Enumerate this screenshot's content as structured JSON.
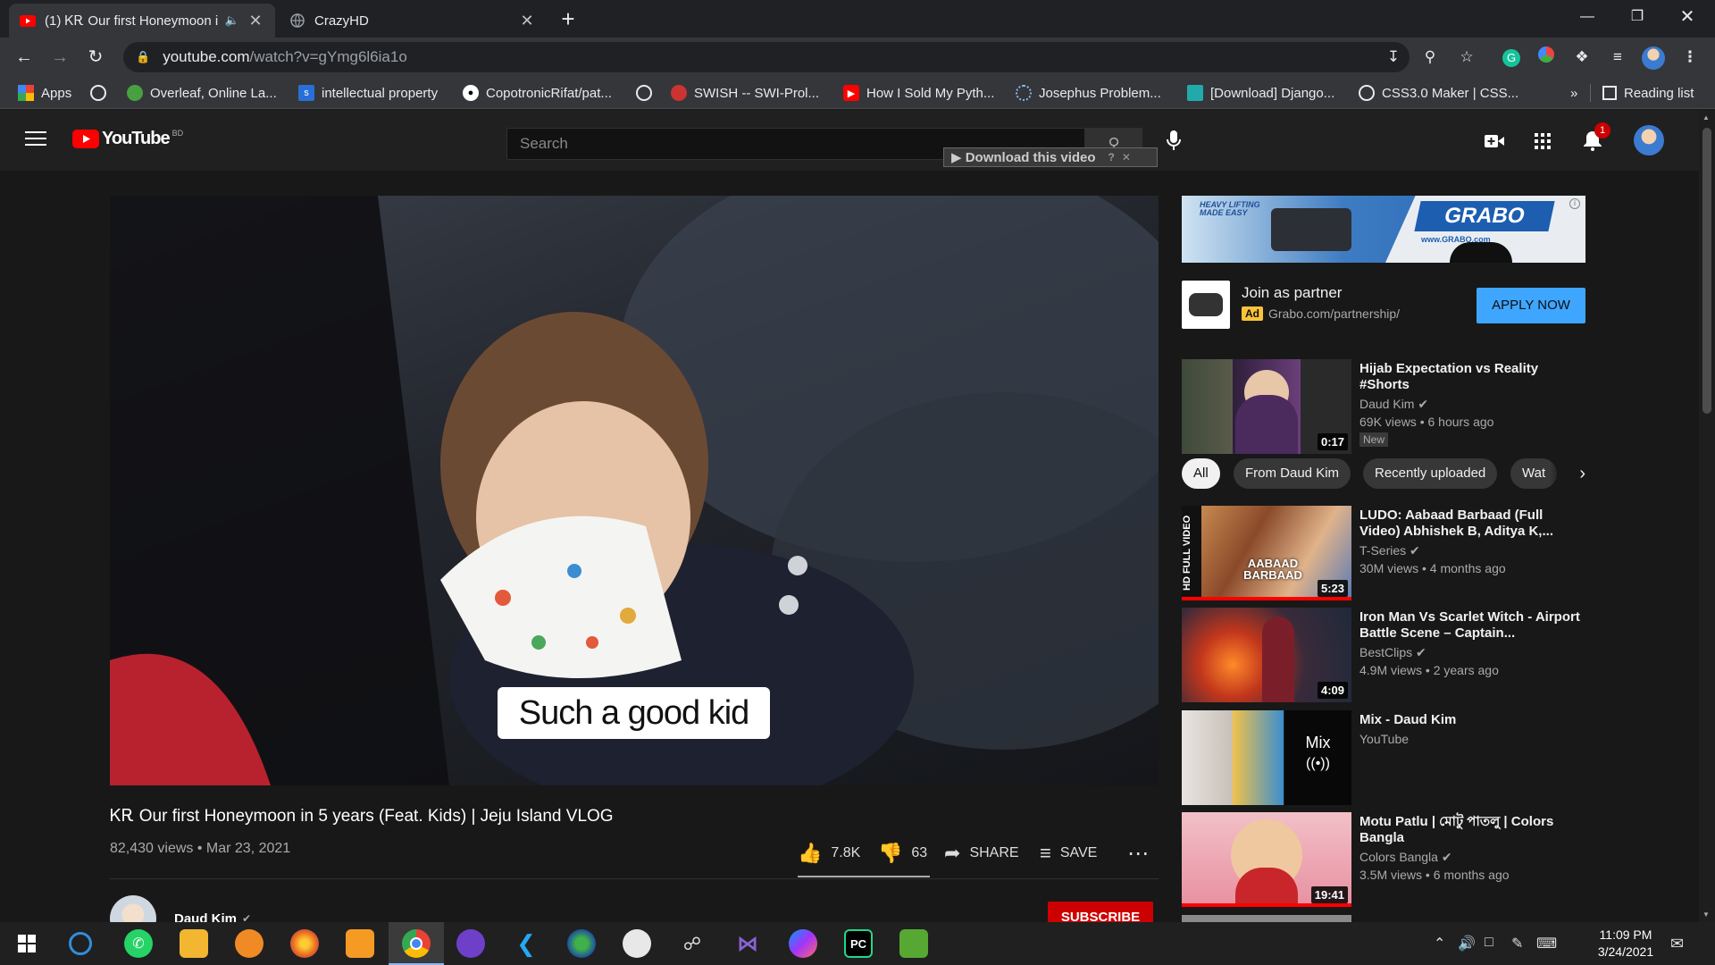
{
  "browser": {
    "tabs": [
      {
        "title": "(1) ᏦᎡ Our first Honeymoon i",
        "active": true
      },
      {
        "title": "CrazyHD",
        "active": false
      }
    ],
    "url_host": "youtube.com",
    "url_path": "/watch?v=gYmg6l6ia1o",
    "bookmarks": [
      {
        "label": "Apps"
      },
      {
        "label": ""
      },
      {
        "label": "Overleaf, Online La..."
      },
      {
        "label": "intellectual property"
      },
      {
        "label": "CopotronicRifat/pat..."
      },
      {
        "label": ""
      },
      {
        "label": "SWISH -- SWI-Prol..."
      },
      {
        "label": "How I Sold My Pyth..."
      },
      {
        "label": "Josephus Problem..."
      },
      {
        "label": "[Download] Django..."
      },
      {
        "label": "CSS3.0 Maker | CSS..."
      }
    ],
    "overflow_label": "»",
    "reading_list": "Reading list",
    "profile_badge": "G"
  },
  "youtube": {
    "logo_text": "YouTube",
    "country": "BD",
    "search_placeholder": "Search",
    "download_bar": "▶ Download this video",
    "notification_count": "1"
  },
  "video": {
    "caption": "Such a good kid",
    "title": "ᏦᎡ Our first Honeymoon in 5 years (Feat. Kids) | Jeju Island VLOG",
    "meta": "82,430 views • Mar 23, 2021",
    "likes": "7.8K",
    "dislikes": "63",
    "share": "SHARE",
    "save": "SAVE",
    "channel": "Daud Kim",
    "subscribe": "SUBSCRIBE"
  },
  "ad": {
    "banner_brand": "GRABO",
    "banner_tag": "HEAVY LIFTING MADE EASY",
    "banner_url": "www.GRABO.com",
    "title": "Join as partner",
    "ad_label": "Ad",
    "url": "Grabo.com/partnership/",
    "cta": "APPLY NOW"
  },
  "chips": [
    "All",
    "From Daud Kim",
    "Recently uploaded",
    "Wat"
  ],
  "recommendations": [
    {
      "title": "Hijab Expectation vs Reality #Shorts",
      "channel": "Daud Kim",
      "stats": "69K views • 6 hours ago",
      "duration": "0:17",
      "badge": "New"
    },
    {
      "title": "LUDO: Aabaad Barbaad (Full Video) Abhishek B, Aditya K,...",
      "channel": "T-Series",
      "stats": "30M views • 4 months ago",
      "duration": "5:23",
      "thumb_text": "AABAAD BARBAAD",
      "side_text": "HD FULL VIDEO"
    },
    {
      "title": "Iron Man Vs Scarlet Witch - Airport Battle Scene – Captain...",
      "channel": "BestClips",
      "stats": "4.9M views • 2 years ago",
      "duration": "4:09"
    },
    {
      "title": "Mix - Daud Kim",
      "channel": "YouTube",
      "mix_label": "Mix"
    },
    {
      "title": "Motu Patlu | মোটু পাতলু | Colors Bangla",
      "channel": "Colors Bangla",
      "stats": "3.5M views • 6 months ago",
      "duration": "19:41"
    }
  ],
  "taskbar": {
    "time": "11:09 PM",
    "date": "3/24/2021"
  }
}
